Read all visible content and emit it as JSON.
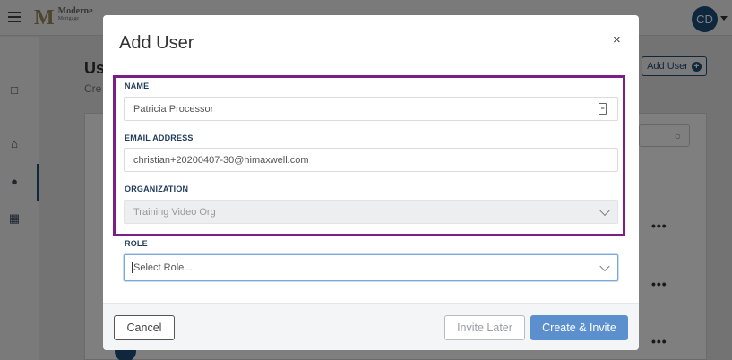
{
  "app": {
    "logo_mark": "M",
    "logo_name": "Moderne",
    "logo_sub": "Mortgage",
    "avatar_initials": "CD",
    "page_title": "Us",
    "page_subtitle": "Cre",
    "add_user_button": "Add User",
    "row_menu": "•••"
  },
  "modal": {
    "title": "Add User",
    "close": "×",
    "name": {
      "label": "NAME",
      "value": "Patricia Processor"
    },
    "email": {
      "label": "EMAIL ADDRESS",
      "value": "christian+20200407-30@himaxwell.com"
    },
    "organization": {
      "label": "ORGANIZATION",
      "value": "Training Video Org"
    },
    "role": {
      "label": "ROLE",
      "placeholder": "Select Role..."
    },
    "buttons": {
      "cancel": "Cancel",
      "invite_later": "Invite Later",
      "create_invite": "Create & Invite"
    }
  },
  "colors": {
    "highlight": "#7b1e86",
    "primary": "#5b8fce",
    "brand": "#1f4e79"
  }
}
